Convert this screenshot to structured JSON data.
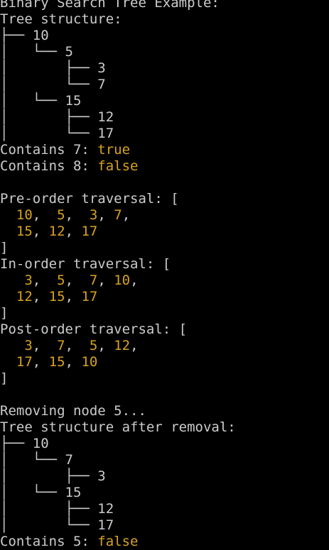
{
  "colors": {
    "background": "#000000",
    "text": "#cccccc",
    "value": "#d7a321"
  },
  "lines": [
    {
      "segments": [
        {
          "t": "Binary Search Tree Example:"
        }
      ]
    },
    {
      "segments": [
        {
          "t": "Tree structure:"
        }
      ]
    },
    {
      "segments": [
        {
          "t": "├── 10"
        }
      ]
    },
    {
      "segments": [
        {
          "t": "│   └── 5"
        }
      ]
    },
    {
      "segments": [
        {
          "t": "│       ├── 3"
        }
      ]
    },
    {
      "segments": [
        {
          "t": "│       └── 7"
        }
      ]
    },
    {
      "segments": [
        {
          "t": "│   └── 15"
        }
      ]
    },
    {
      "segments": [
        {
          "t": "│       ├── 12"
        }
      ]
    },
    {
      "segments": [
        {
          "t": "│       └── 17"
        }
      ]
    },
    {
      "segments": [
        {
          "t": "Contains 7: "
        },
        {
          "t": "true",
          "v": true
        }
      ]
    },
    {
      "segments": [
        {
          "t": "Contains 8: "
        },
        {
          "t": "false",
          "v": true
        }
      ]
    },
    {
      "segments": [
        {
          "t": ""
        }
      ]
    },
    {
      "segments": [
        {
          "t": "Pre-order traversal: ["
        }
      ]
    },
    {
      "segments": [
        {
          "t": "  "
        },
        {
          "t": "10",
          "v": true
        },
        {
          "t": ",  "
        },
        {
          "t": "5",
          "v": true
        },
        {
          "t": ",  "
        },
        {
          "t": "3",
          "v": true
        },
        {
          "t": ", "
        },
        {
          "t": "7",
          "v": true
        },
        {
          "t": ","
        }
      ]
    },
    {
      "segments": [
        {
          "t": "  "
        },
        {
          "t": "15",
          "v": true
        },
        {
          "t": ", "
        },
        {
          "t": "12",
          "v": true
        },
        {
          "t": ", "
        },
        {
          "t": "17",
          "v": true
        }
      ]
    },
    {
      "segments": [
        {
          "t": "]"
        }
      ]
    },
    {
      "segments": [
        {
          "t": "In-order traversal: ["
        }
      ]
    },
    {
      "segments": [
        {
          "t": "   "
        },
        {
          "t": "3",
          "v": true
        },
        {
          "t": ",  "
        },
        {
          "t": "5",
          "v": true
        },
        {
          "t": ",  "
        },
        {
          "t": "7",
          "v": true
        },
        {
          "t": ", "
        },
        {
          "t": "10",
          "v": true
        },
        {
          "t": ","
        }
      ]
    },
    {
      "segments": [
        {
          "t": "  "
        },
        {
          "t": "12",
          "v": true
        },
        {
          "t": ", "
        },
        {
          "t": "15",
          "v": true
        },
        {
          "t": ", "
        },
        {
          "t": "17",
          "v": true
        }
      ]
    },
    {
      "segments": [
        {
          "t": "]"
        }
      ]
    },
    {
      "segments": [
        {
          "t": "Post-order traversal: ["
        }
      ]
    },
    {
      "segments": [
        {
          "t": "   "
        },
        {
          "t": "3",
          "v": true
        },
        {
          "t": ",  "
        },
        {
          "t": "7",
          "v": true
        },
        {
          "t": ",  "
        },
        {
          "t": "5",
          "v": true
        },
        {
          "t": ", "
        },
        {
          "t": "12",
          "v": true
        },
        {
          "t": ","
        }
      ]
    },
    {
      "segments": [
        {
          "t": "  "
        },
        {
          "t": "17",
          "v": true
        },
        {
          "t": ", "
        },
        {
          "t": "15",
          "v": true
        },
        {
          "t": ", "
        },
        {
          "t": "10",
          "v": true
        }
      ]
    },
    {
      "segments": [
        {
          "t": "]"
        }
      ]
    },
    {
      "segments": [
        {
          "t": ""
        }
      ]
    },
    {
      "segments": [
        {
          "t": "Removing node 5..."
        }
      ]
    },
    {
      "segments": [
        {
          "t": "Tree structure after removal:"
        }
      ]
    },
    {
      "segments": [
        {
          "t": "├── 10"
        }
      ]
    },
    {
      "segments": [
        {
          "t": "│   └── 7"
        }
      ]
    },
    {
      "segments": [
        {
          "t": "│       ├── 3"
        }
      ]
    },
    {
      "segments": [
        {
          "t": "│   └── 15"
        }
      ]
    },
    {
      "segments": [
        {
          "t": "│       ├── 12"
        }
      ]
    },
    {
      "segments": [
        {
          "t": "│       └── 17"
        }
      ]
    },
    {
      "segments": [
        {
          "t": "Contains 5: "
        },
        {
          "t": "false",
          "v": true
        }
      ]
    }
  ]
}
